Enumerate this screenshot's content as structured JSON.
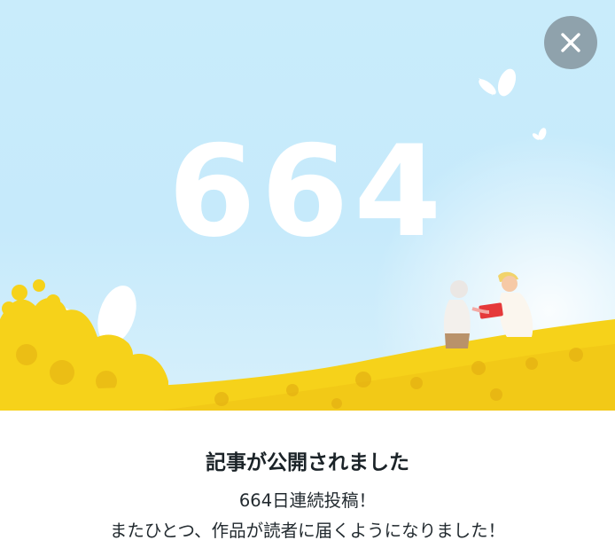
{
  "dialog": {
    "streak_number": "664",
    "close_icon": "close-icon",
    "title": "記事が公開されました",
    "message_line1": "664日連続投稿！",
    "message_line2": "またひとつ、作品が読者に届くようになりました！"
  },
  "colors": {
    "sky": "#c9ecfb",
    "flowers": "#f6d21a",
    "close_button": "#8fa2ac",
    "number": "#ffffff"
  }
}
